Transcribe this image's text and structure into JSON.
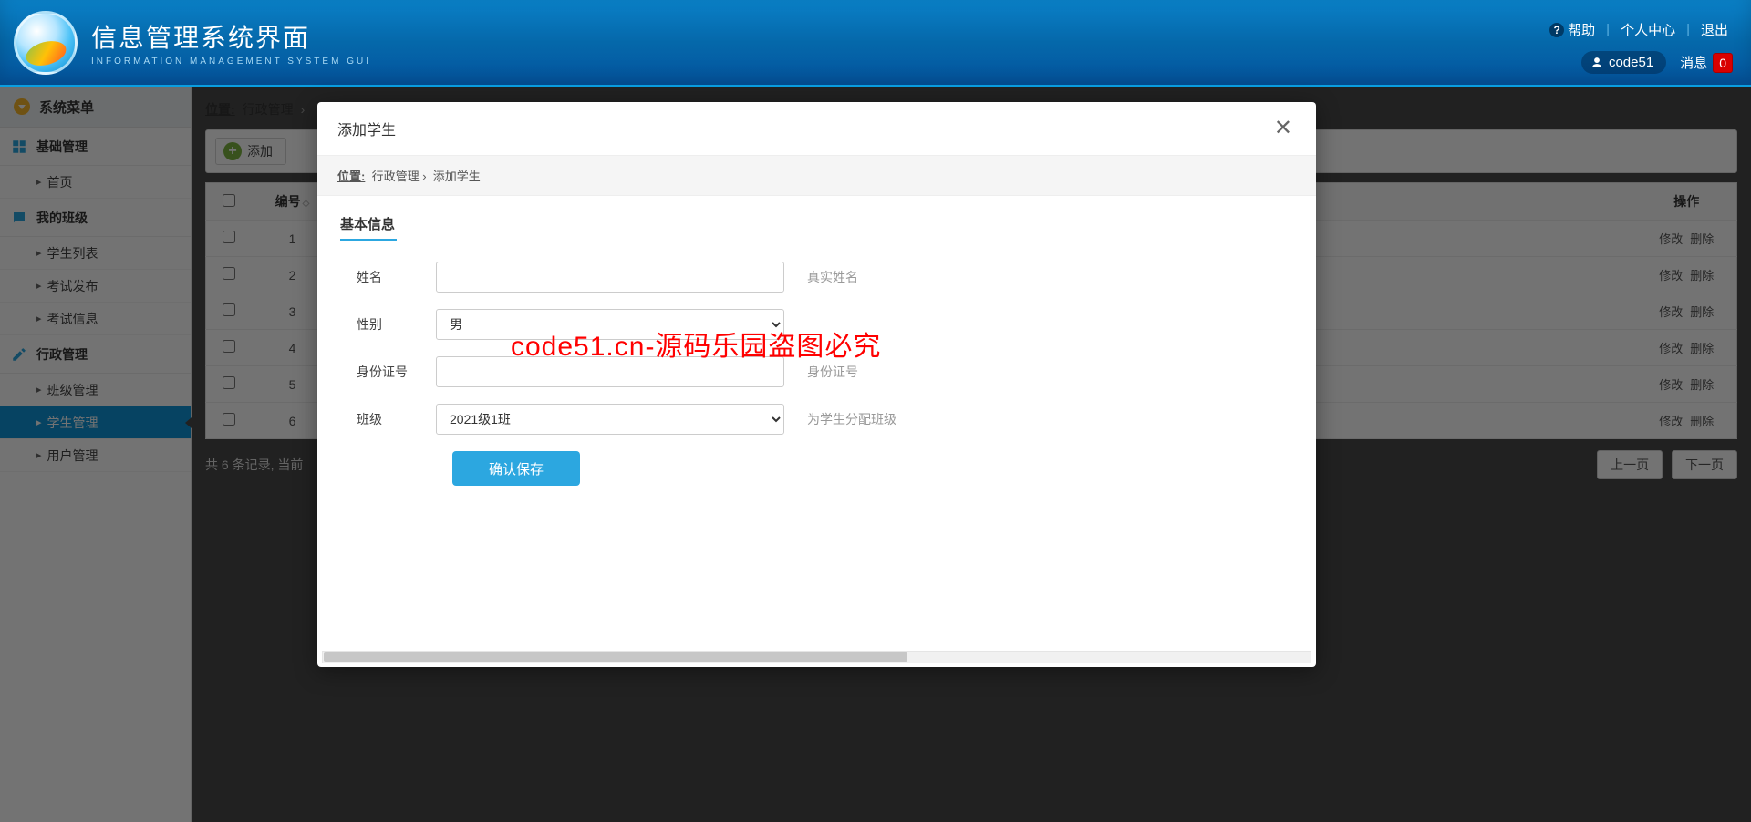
{
  "header": {
    "title": "信息管理系统界面",
    "subtitle": "INFORMATION MANAGEMENT SYSTEM GUI",
    "links": {
      "help": "帮助",
      "personal": "个人中心",
      "logout": "退出"
    },
    "user": "code51",
    "msg_label": "消息",
    "msg_count": "0"
  },
  "sidebar": {
    "menu_title": "系统菜单",
    "cats": [
      {
        "label": "基础管理",
        "icon": "grid",
        "subs": [
          {
            "label": "首页"
          }
        ]
      },
      {
        "label": "我的班级",
        "icon": "chat",
        "subs": [
          {
            "label": "学生列表"
          },
          {
            "label": "考试发布"
          },
          {
            "label": "考试信息"
          }
        ]
      },
      {
        "label": "行政管理",
        "icon": "edit",
        "subs": [
          {
            "label": "班级管理"
          },
          {
            "label": "学生管理",
            "active": true
          },
          {
            "label": "用户管理"
          }
        ]
      }
    ]
  },
  "page": {
    "crumb_label": "位置:",
    "crumb1": "行政管理",
    "add_label": "添加",
    "cols": {
      "id": "编号",
      "ops": "操作"
    },
    "rows": [
      {
        "id": "1"
      },
      {
        "id": "2"
      },
      {
        "id": "3"
      },
      {
        "id": "4"
      },
      {
        "id": "5"
      },
      {
        "id": "6"
      }
    ],
    "row_ops": {
      "edit": "修改",
      "del": "删除"
    },
    "pager_info_prefix": "共 6 条记录,",
    "pager_info_cur": "当前",
    "prev": "上一页",
    "next": "下一页"
  },
  "modal": {
    "title": "添加学生",
    "crumb_label": "位置:",
    "crumb1": "行政管理",
    "crumb2": "添加学生",
    "section": "基本信息",
    "fields": {
      "name": {
        "label": "姓名",
        "hint": "真实姓名",
        "value": ""
      },
      "gender": {
        "label": "性别",
        "hint": "",
        "value": "男"
      },
      "idcard": {
        "label": "身份证号",
        "hint": "身份证号",
        "value": ""
      },
      "class": {
        "label": "班级",
        "hint": "为学生分配班级",
        "value": "2021级1班"
      }
    },
    "submit": "确认保存"
  },
  "watermark": "code51.cn-源码乐园盗图必究"
}
